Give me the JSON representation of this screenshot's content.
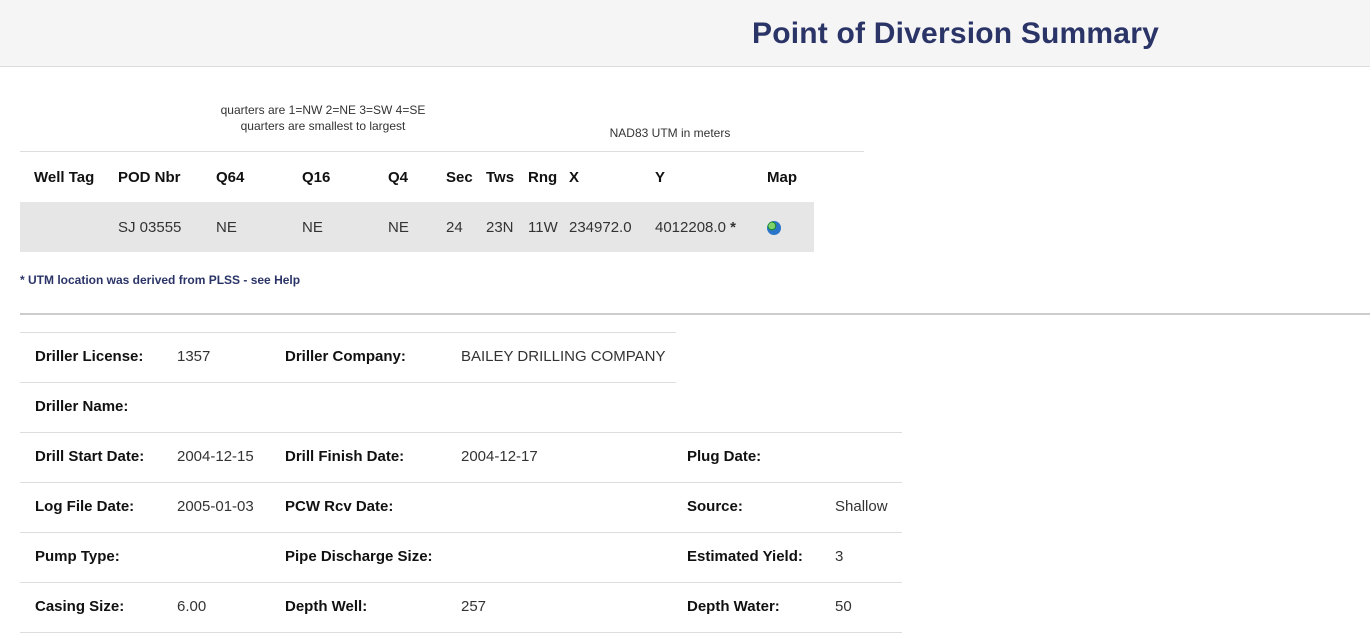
{
  "page": {
    "title": "Point of Diversion Summary"
  },
  "notes": {
    "quarters_line1": "quarters are 1=NW 2=NE 3=SW 4=SE",
    "quarters_line2": "quarters are smallest to largest",
    "utm_units": "NAD83 UTM in meters"
  },
  "pod_table": {
    "headers": [
      "Well Tag",
      "POD Nbr",
      "Q64",
      "Q16",
      "Q4",
      "Sec",
      "Tws",
      "Rng",
      "X",
      "Y",
      "Map"
    ],
    "row": {
      "well_tag": "",
      "pod_nbr": "SJ 03555",
      "q64": "NE",
      "q16": "NE",
      "q4": "NE",
      "sec": "24",
      "tws": "23N",
      "rng": "11W",
      "x": "234972.0",
      "y": "4012208.0",
      "y_flag": "*",
      "map_icon": "globe-icon"
    }
  },
  "footnote": "* UTM location was derived from PLSS - see Help",
  "details": {
    "driller_license": {
      "label": "Driller License:",
      "value": "1357"
    },
    "driller_company": {
      "label": "Driller Company:",
      "value": "BAILEY DRILLING COMPANY"
    },
    "driller_name": {
      "label": "Driller Name:",
      "value": ""
    },
    "drill_start_date": {
      "label": "Drill Start Date:",
      "value": "2004-12-15"
    },
    "drill_finish_date": {
      "label": "Drill Finish Date:",
      "value": "2004-12-17"
    },
    "plug_date": {
      "label": "Plug Date:",
      "value": ""
    },
    "log_file_date": {
      "label": "Log File Date:",
      "value": "2005-01-03"
    },
    "pcw_rcv_date": {
      "label": "PCW Rcv Date:",
      "value": ""
    },
    "source": {
      "label": "Source:",
      "value": "Shallow"
    },
    "pump_type": {
      "label": "Pump Type:",
      "value": ""
    },
    "pipe_discharge_size": {
      "label": "Pipe Discharge Size:",
      "value": ""
    },
    "estimated_yield": {
      "label": "Estimated Yield:",
      "value": "3"
    },
    "casing_size": {
      "label": "Casing Size:",
      "value": "6.00"
    },
    "depth_well": {
      "label": "Depth Well:",
      "value": "257"
    },
    "depth_water": {
      "label": "Depth Water:",
      "value": "50"
    }
  }
}
